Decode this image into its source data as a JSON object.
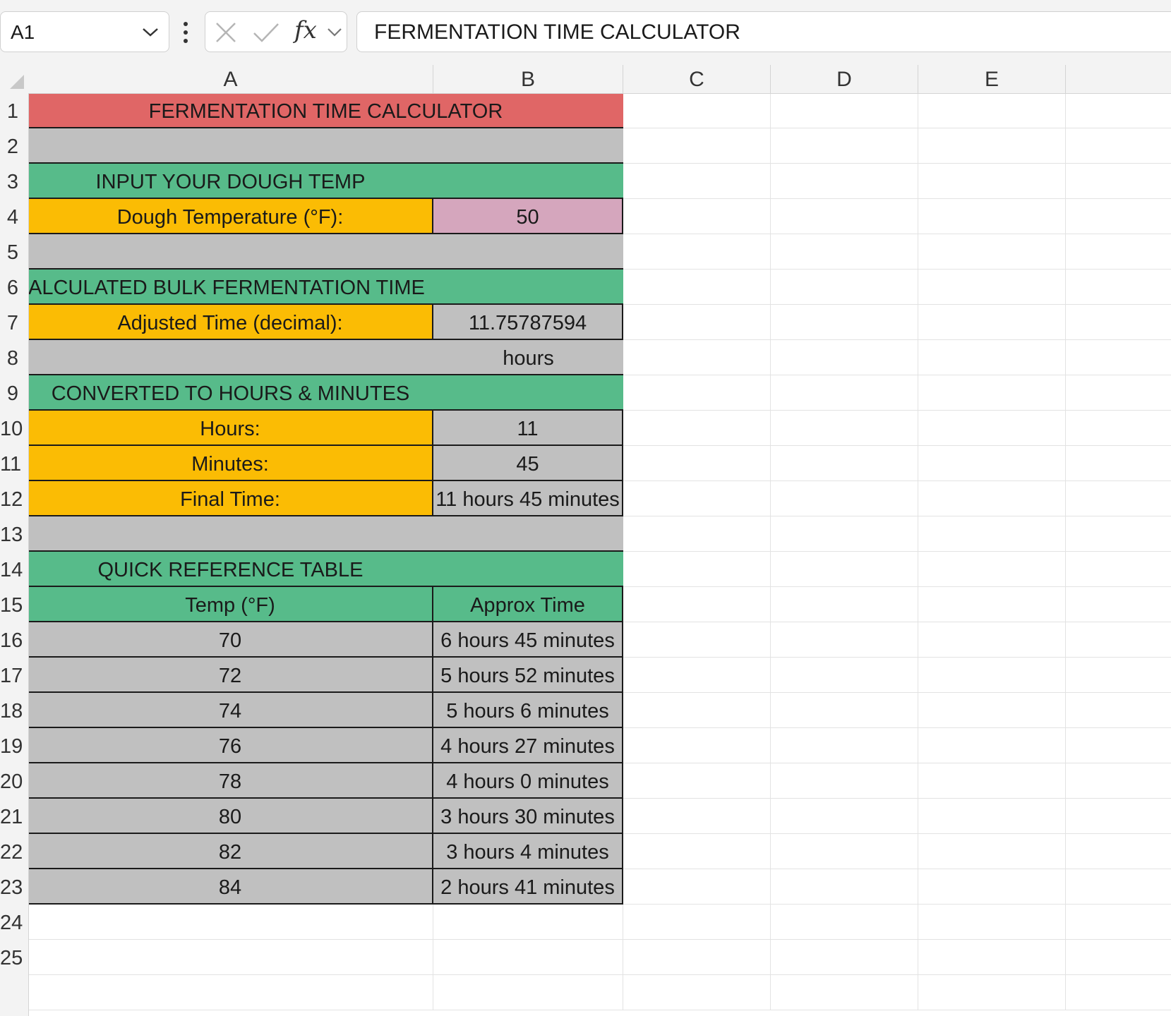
{
  "formula_bar": {
    "name_box": "A1",
    "formula": "FERMENTATION TIME CALCULATOR",
    "fx": "fx"
  },
  "columns": [
    "A",
    "B",
    "C",
    "D",
    "E"
  ],
  "rows": [
    "1",
    "2",
    "3",
    "4",
    "5",
    "6",
    "7",
    "8",
    "9",
    "10",
    "11",
    "12",
    "13",
    "14",
    "15",
    "16",
    "17",
    "18",
    "19",
    "20",
    "21",
    "22",
    "23",
    "24",
    "25"
  ],
  "sheet": {
    "title": "FERMENTATION TIME CALCULATOR",
    "input_header": "INPUT YOUR DOUGH TEMP",
    "dough_temp_label": "Dough Temperature (°F):",
    "dough_temp_value": "50",
    "calc_header": "ALCULATED BULK FERMENTATION TIME",
    "adjusted_label": "Adjusted Time (decimal):",
    "adjusted_value": "11.75787594",
    "hours_unit": "hours",
    "converted_header": "CONVERTED TO HOURS & MINUTES",
    "hours_label": "Hours:",
    "hours_value": "11",
    "minutes_label": "Minutes:",
    "minutes_value": "45",
    "final_label": "Final Time:",
    "final_value": "11 hours 45 minutes",
    "ref_header": "QUICK REFERENCE TABLE",
    "ref_col_temp": "Temp (°F)",
    "ref_col_time": "Approx Time",
    "ref_rows": [
      {
        "temp": "70",
        "time": "6 hours 45 minutes"
      },
      {
        "temp": "72",
        "time": "5 hours 52 minutes"
      },
      {
        "temp": "74",
        "time": "5 hours 6 minutes"
      },
      {
        "temp": "76",
        "time": "4 hours 27 minutes"
      },
      {
        "temp": "78",
        "time": "4 hours 0 minutes"
      },
      {
        "temp": "80",
        "time": "3 hours 30 minutes"
      },
      {
        "temp": "82",
        "time": "3 hours 4 minutes"
      },
      {
        "temp": "84",
        "time": "2 hours 41 minutes"
      }
    ]
  },
  "colors": {
    "title_fill": "#e06666",
    "section_fill": "#57bb8a",
    "label_fill": "#fbbc04",
    "input_fill": "#d5a6bd",
    "filler_fill": "#c0c0c0"
  }
}
